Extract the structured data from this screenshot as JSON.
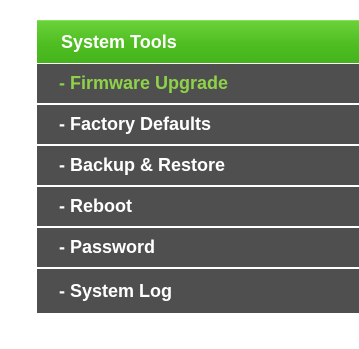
{
  "menu": {
    "header_label": "System Tools",
    "items": [
      {
        "label": "- Firmware Upgrade",
        "active": true
      },
      {
        "label": "- Factory Defaults",
        "active": false
      },
      {
        "label": "- Backup & Restore",
        "active": false
      },
      {
        "label": "- Reboot",
        "active": false
      },
      {
        "label": "- Password",
        "active": false
      },
      {
        "label": "- System Log",
        "active": false
      }
    ]
  },
  "colors": {
    "header_green": "#4fbe22",
    "item_background": "#4f4f4f",
    "active_text": "#8fd24a",
    "text": "#ffffff"
  }
}
